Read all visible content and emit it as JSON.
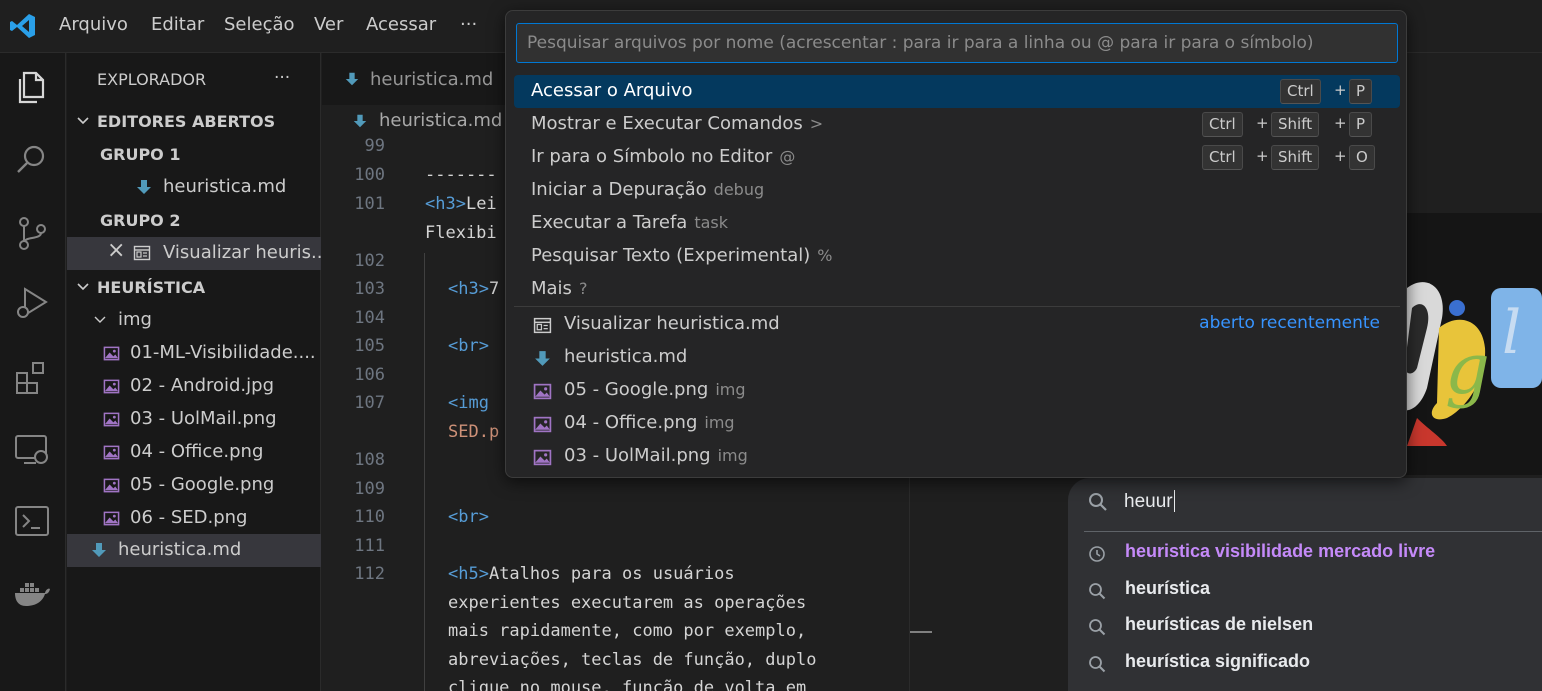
{
  "menubar": {
    "items": [
      "Arquivo",
      "Editar",
      "Seleção",
      "Ver",
      "Acessar",
      "···"
    ]
  },
  "sidebar": {
    "title": "EXPLORADOR",
    "more": "···",
    "open_editors": "EDITORES ABERTOS",
    "group1": "GRUPO 1",
    "group1_file": "heuristica.md",
    "group2": "GRUPO 2",
    "group2_file": "Visualizar heuris...",
    "close_glyph": "×",
    "folder": "HEURÍSTICA",
    "subfolder": "img",
    "files": [
      "01-ML-Visibilidade....",
      "02 - Android.jpg",
      "03 - UolMail.png",
      "04 - Office.png",
      "05 - Google.png",
      "06 - SED.png"
    ],
    "root_file": "heuristica.md"
  },
  "editor": {
    "tab": "heuristica.md",
    "breadcrumb": "heuristica.md",
    "line_numbers": [
      "99",
      "100",
      "101",
      "",
      "102",
      "103",
      "104",
      "105",
      "106",
      "107",
      "",
      "108",
      "109",
      "110",
      "111",
      "112"
    ],
    "code": {
      "l100": "-------",
      "l101_tag": "<h3>",
      "l101_text": "Lei",
      "l101b": "Flexibi",
      "l103_tag": "<h3>",
      "l103_text": "7",
      "l105": "<br>",
      "l107_tag": "<img",
      "l107b": "SED.p",
      "l110": "<br>",
      "l112_tag": "<h5>",
      "l112_text": "Atalhos para os usuários",
      "l112b": "experientes executarem as operações",
      "l112c": "mais rapidamente, como por exemplo,",
      "l112d": "abreviações, teclas de função, duplo",
      "l112e": "clique no mouse, função de volta em"
    }
  },
  "quickpick": {
    "placeholder": "Pesquisar arquivos por nome (acrescentar : para ir para a linha ou @ para ir para o símbolo)",
    "commands": [
      {
        "label": "Acessar o Arquivo",
        "detail": "",
        "keys": [
          "Ctrl",
          "P"
        ]
      },
      {
        "label": "Mostrar e Executar Comandos",
        "detail": ">",
        "keys": [
          "Ctrl",
          "Shift",
          "P"
        ]
      },
      {
        "label": "Ir para o Símbolo no Editor",
        "detail": "@",
        "keys": [
          "Ctrl",
          "Shift",
          "O"
        ]
      },
      {
        "label": "Iniciar a Depuração",
        "detail": "debug",
        "keys": []
      },
      {
        "label": "Executar a Tarefa",
        "detail": "task",
        "keys": []
      },
      {
        "label": "Pesquisar Texto (Experimental)",
        "detail": "%",
        "keys": []
      },
      {
        "label": "Mais",
        "detail": "?",
        "keys": []
      }
    ],
    "plus": "+",
    "recent_label": "aberto recentemente",
    "recent": [
      {
        "label": "Visualizar heuristica.md",
        "detail": "",
        "icon": "preview-icon"
      },
      {
        "label": "heuristica.md",
        "detail": "",
        "icon": "markdown-icon"
      },
      {
        "label": "05 - Google.png",
        "detail": "img",
        "icon": "image-icon"
      },
      {
        "label": "04 - Office.png",
        "detail": "img",
        "icon": "image-icon"
      },
      {
        "label": "03 - UolMail.png",
        "detail": "img",
        "icon": "image-icon"
      }
    ]
  },
  "google": {
    "query": "heuur",
    "suggestions": [
      {
        "text": "heuristica visibilidade mercado livre",
        "icon": "history-icon",
        "color": "#c58af9"
      },
      {
        "text": "heurística",
        "icon": "search-icon",
        "color": "#e8eaed"
      },
      {
        "text": "heurísticas de nielsen",
        "icon": "search-icon",
        "color": "#e8eaed"
      },
      {
        "text": "heurística significado",
        "icon": "search-icon",
        "color": "#e8eaed"
      }
    ]
  },
  "colors": {
    "accent": "#0078d4",
    "selection": "#04395e",
    "link": "#3794ff",
    "markdown_icon": "#519aba",
    "image_icon": "#a074c4"
  }
}
